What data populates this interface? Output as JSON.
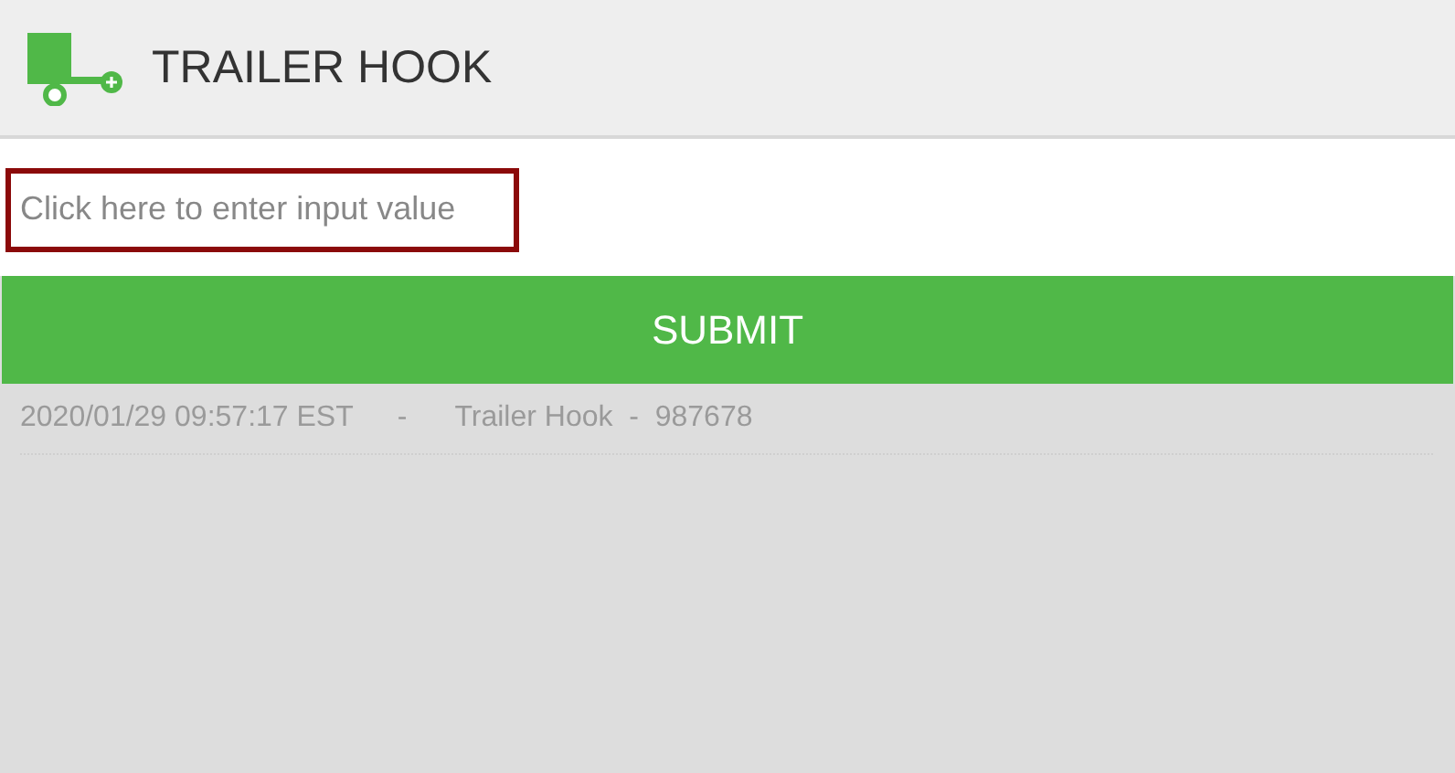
{
  "header": {
    "title": "TRAILER HOOK"
  },
  "input": {
    "placeholder": "Click here to enter input value"
  },
  "submit": {
    "label": "SUBMIT"
  },
  "log": [
    {
      "time": "2020/01/29 09:57:17 EST",
      "separator": "-",
      "entry": "Trailer Hook  -  987678"
    }
  ]
}
